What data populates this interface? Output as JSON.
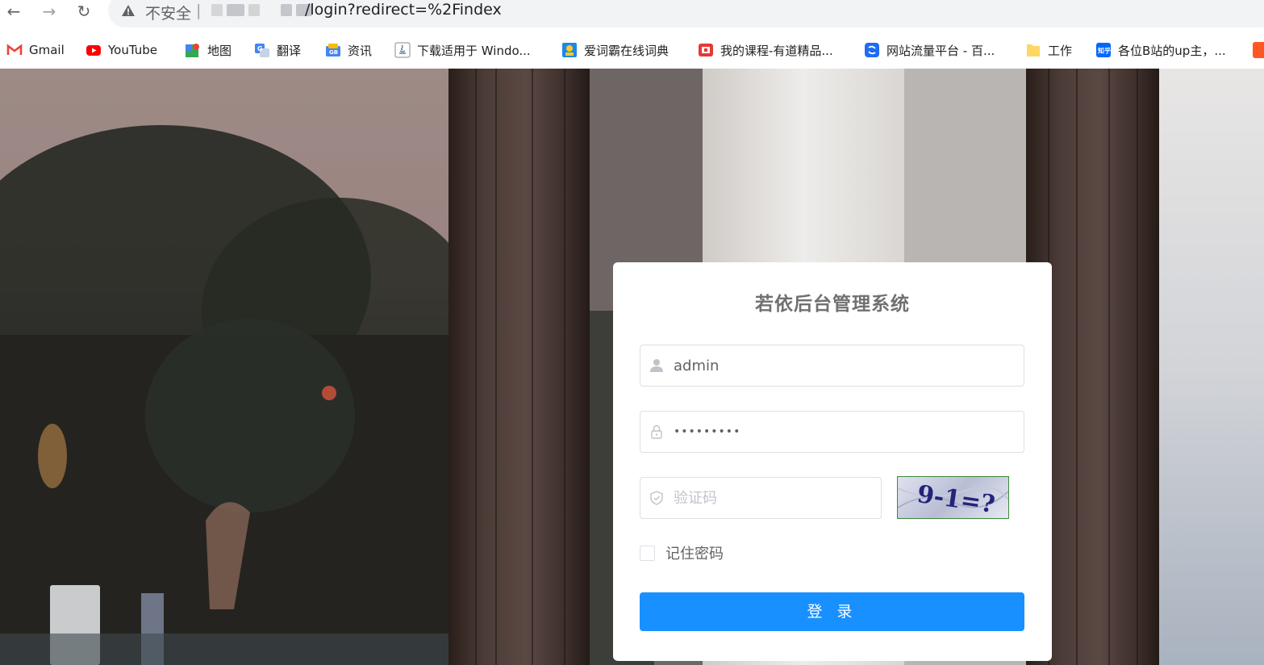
{
  "browser": {
    "security_label": "不安全",
    "separator": "|",
    "url_path": "/login?redirect=%2Findex",
    "bookmarks": [
      {
        "label": "Gmail",
        "icon": "gmail-icon",
        "color": "#ea4335"
      },
      {
        "label": "YouTube",
        "icon": "youtube-icon",
        "color": "#ff0000"
      },
      {
        "label": "地图",
        "icon": "maps-icon",
        "color": "#34a853"
      },
      {
        "label": "翻译",
        "icon": "translate-icon",
        "color": "#4285f4"
      },
      {
        "label": "资讯",
        "icon": "news-icon",
        "color": "#4285f4"
      },
      {
        "label": "下载适用于 Windo...",
        "icon": "java-download-icon",
        "color": "#5382a1"
      },
      {
        "label": "爱词霸在线词典",
        "icon": "iciba-icon",
        "color": "#1e88e5"
      },
      {
        "label": "我的课程-有道精品...",
        "icon": "youdao-icon",
        "color": "#e53935"
      },
      {
        "label": "网站流量平台 - 百...",
        "icon": "baidu-tongji-icon",
        "color": "#1e6cf0"
      },
      {
        "label": "工作",
        "icon": "folder-icon",
        "color": "#fdd663"
      },
      {
        "label": "各位B站的up主，...",
        "icon": "zhihu-icon",
        "color": "#0066ff"
      }
    ]
  },
  "login": {
    "title": "若依后台管理系统",
    "username_value": "admin",
    "password_value": "•••••••••",
    "code_placeholder": "验证码",
    "captcha_text": "9-1=?",
    "remember_label": "记住密码",
    "submit_label": "登 录"
  },
  "colors": {
    "primary": "#1890ff",
    "border": "#dcdfe6",
    "title_text": "#707070"
  }
}
